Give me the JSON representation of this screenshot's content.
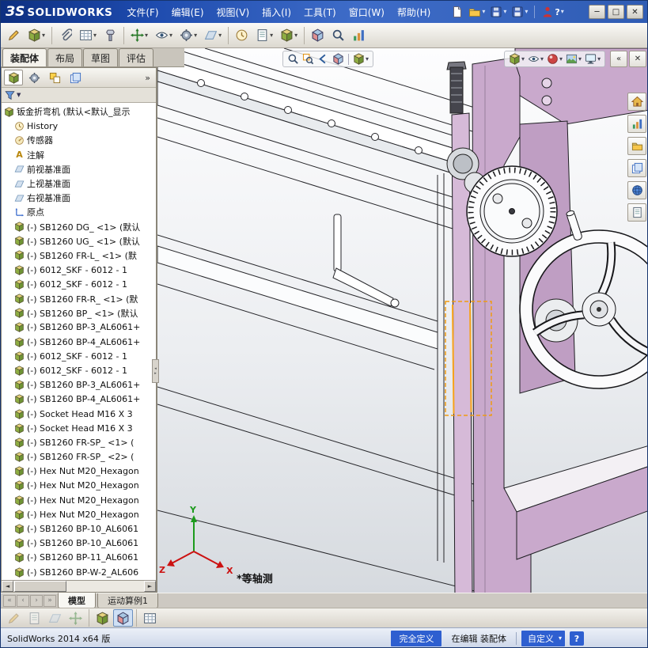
{
  "titlebar": {
    "logo_prefix": "ЗS",
    "logo_text": "SOLIDWORKS",
    "menus": [
      "文件(F)",
      "编辑(E)",
      "视图(V)",
      "插入(I)",
      "工具(T)",
      "窗口(W)",
      "帮助(H)"
    ]
  },
  "icons": {
    "caret": "▾",
    "caret_down": "▼",
    "chevrons": "»",
    "chevrons_left": "«",
    "close": "✕",
    "minimize": "─",
    "maximize": "□",
    "nav_first": "«",
    "nav_prev": "‹",
    "nav_next": "›",
    "nav_last": "»",
    "scroll_left": "◄",
    "scroll_right": "►",
    "splitter_left": "◂",
    "splitter_right": "▸",
    "help": "?",
    "annotations_glyph": "A"
  },
  "command_tabs": [
    "装配体",
    "布局",
    "草图",
    "评估"
  ],
  "feature_tree": {
    "root_label": "钣金折弯机 (默认<默认_显示",
    "folders": [
      {
        "label": "History"
      },
      {
        "label": "传感器"
      },
      {
        "label": "注解"
      },
      {
        "label": "前视基准面"
      },
      {
        "label": "上视基准面"
      },
      {
        "label": "右视基准面"
      },
      {
        "label": "原点"
      }
    ],
    "components": [
      "(-) SB1260 DG_ <1> (默认",
      "(-) SB1260 UG_ <1> (默认",
      "(-) SB1260 FR-L_ <1> (默",
      "(-) 6012_SKF - 6012 - 1",
      "(-) 6012_SKF - 6012 - 1",
      "(-) SB1260 FR-R_ <1> (默",
      "(-) SB1260 BP_ <1> (默认",
      "(-) SB1260 BP-3_AL6061+",
      "(-) SB1260 BP-4_AL6061+",
      "(-) 6012_SKF - 6012 - 1",
      "(-) 6012_SKF - 6012 - 1",
      "(-) SB1260 BP-3_AL6061+",
      "(-) SB1260 BP-4_AL6061+",
      "(-) Socket Head M16 X 3",
      "(-) Socket Head M16 X 3",
      "(-) SB1260 FR-SP_ <1> (",
      "(-) SB1260 FR-SP_ <2> (",
      "(-) Hex Nut M20_Hexagon",
      "(-) Hex Nut M20_Hexagon",
      "(-) Hex Nut M20_Hexagon",
      "(-) Hex Nut M20_Hexagon",
      "(-) SB1260 BP-10_AL6061",
      "(-) SB1260 BP-10_AL6061",
      "(-) SB1260 BP-11_AL6061",
      "(-) SB1260 BP-W-2_AL606"
    ]
  },
  "viewport": {
    "view_label": "*等轴测",
    "axis_x": "X",
    "axis_y": "Y",
    "axis_z": "Z"
  },
  "bottom_tabs": [
    "模型",
    "运动算例1"
  ],
  "statusbar": {
    "app_version": "SolidWorks 2014 x64 版",
    "defined_state": "完全定义",
    "edit_state": "在编辑 装配体",
    "custom_label": "自定义"
  }
}
